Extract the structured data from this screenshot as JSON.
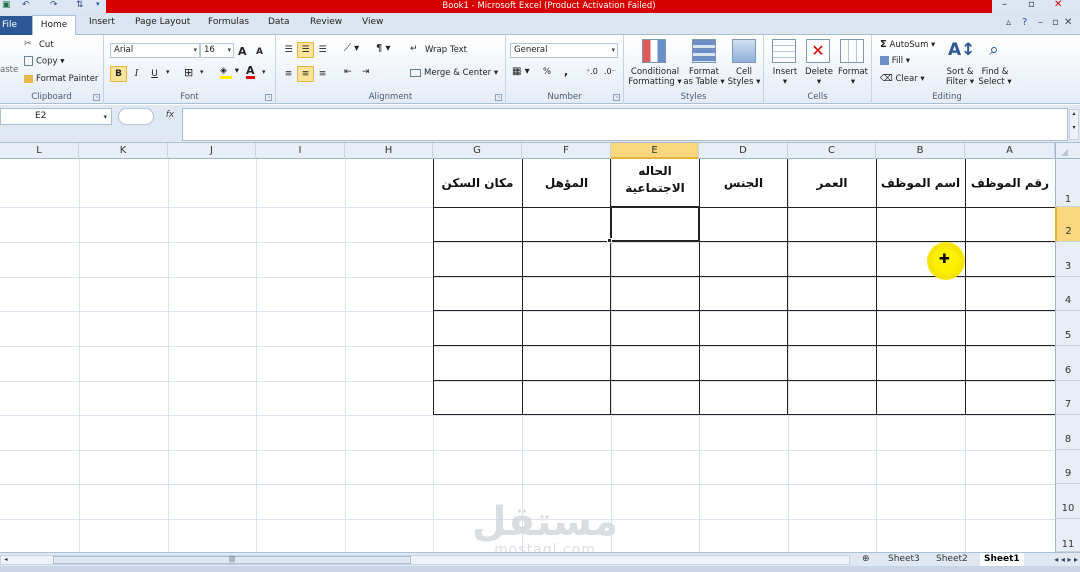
{
  "window": {
    "title": "Book1 - Microsoft Excel (Product Activation Failed)",
    "qat_icons": [
      "excel-icon",
      "undo-icon",
      "redo-icon",
      "sort-icon"
    ]
  },
  "tabs": [
    {
      "label": "File"
    },
    {
      "label": "Home"
    },
    {
      "label": "Insert"
    },
    {
      "label": "Page Layout"
    },
    {
      "label": "Formulas"
    },
    {
      "label": "Data"
    },
    {
      "label": "Review"
    },
    {
      "label": "View"
    }
  ],
  "ribbon": {
    "clipboard": {
      "paste_label": "aste",
      "cut": "Cut",
      "copy": "Copy",
      "format_painter": "Format Painter",
      "group_label": "Clipboard"
    },
    "font": {
      "font_name": "Arial",
      "font_size": "16",
      "grow": "A",
      "shrink": "A",
      "bold": "B",
      "italic": "I",
      "underline": "U",
      "color_a": "A",
      "group_label": "Font"
    },
    "alignment": {
      "wrap_text": "Wrap Text",
      "merge_center": "Merge & Center",
      "group_label": "Alignment"
    },
    "number": {
      "format": "General",
      "percent": "%",
      "comma": ",",
      "group_label": "Number"
    },
    "styles": {
      "conditional_formatting_1": "Conditional",
      "conditional_formatting_2": "Formatting",
      "format_table_1": "Format",
      "format_table_2": "as Table",
      "cell_styles_1": "Cell",
      "cell_styles_2": "Styles",
      "group_label": "Styles"
    },
    "cells": {
      "insert": "Insert",
      "delete": "Delete",
      "format": "Format",
      "group_label": "Cells"
    },
    "editing": {
      "autosum": "AutoSum",
      "fill": "Fill",
      "clear": "Clear",
      "sort_filter_1": "Sort &",
      "sort_filter_2": "Filter",
      "find_select_1": "Find &",
      "find_select_2": "Select",
      "group_label": "Editing"
    }
  },
  "formula_bar": {
    "name_box": "E2",
    "fx_label": "fx",
    "formula": ""
  },
  "columns": [
    "L",
    "K",
    "J",
    "I",
    "H",
    "G",
    "F",
    "E",
    "D",
    "C",
    "B",
    "A"
  ],
  "rows": [
    "1",
    "2",
    "3",
    "4",
    "5",
    "6",
    "7",
    "8",
    "9",
    "10",
    "11"
  ],
  "selected": {
    "column": "E",
    "row": "2"
  },
  "table_headers": {
    "A": "رقم الموظف",
    "B": "اسم الموظف",
    "C": "العمر",
    "D": "الجنس",
    "E1": "الحاله",
    "E2": "الاجتماعية",
    "F": "المؤهل",
    "G": "مكان السكن"
  },
  "watermark": {
    "arabic": "مستقل",
    "latin": "mostaql.com"
  },
  "sheets": [
    {
      "name": "Sheet3"
    },
    {
      "name": "Sheet2"
    },
    {
      "name": "Sheet1"
    }
  ],
  "sheet_nav": "◂ ◂ ▸ ▸"
}
